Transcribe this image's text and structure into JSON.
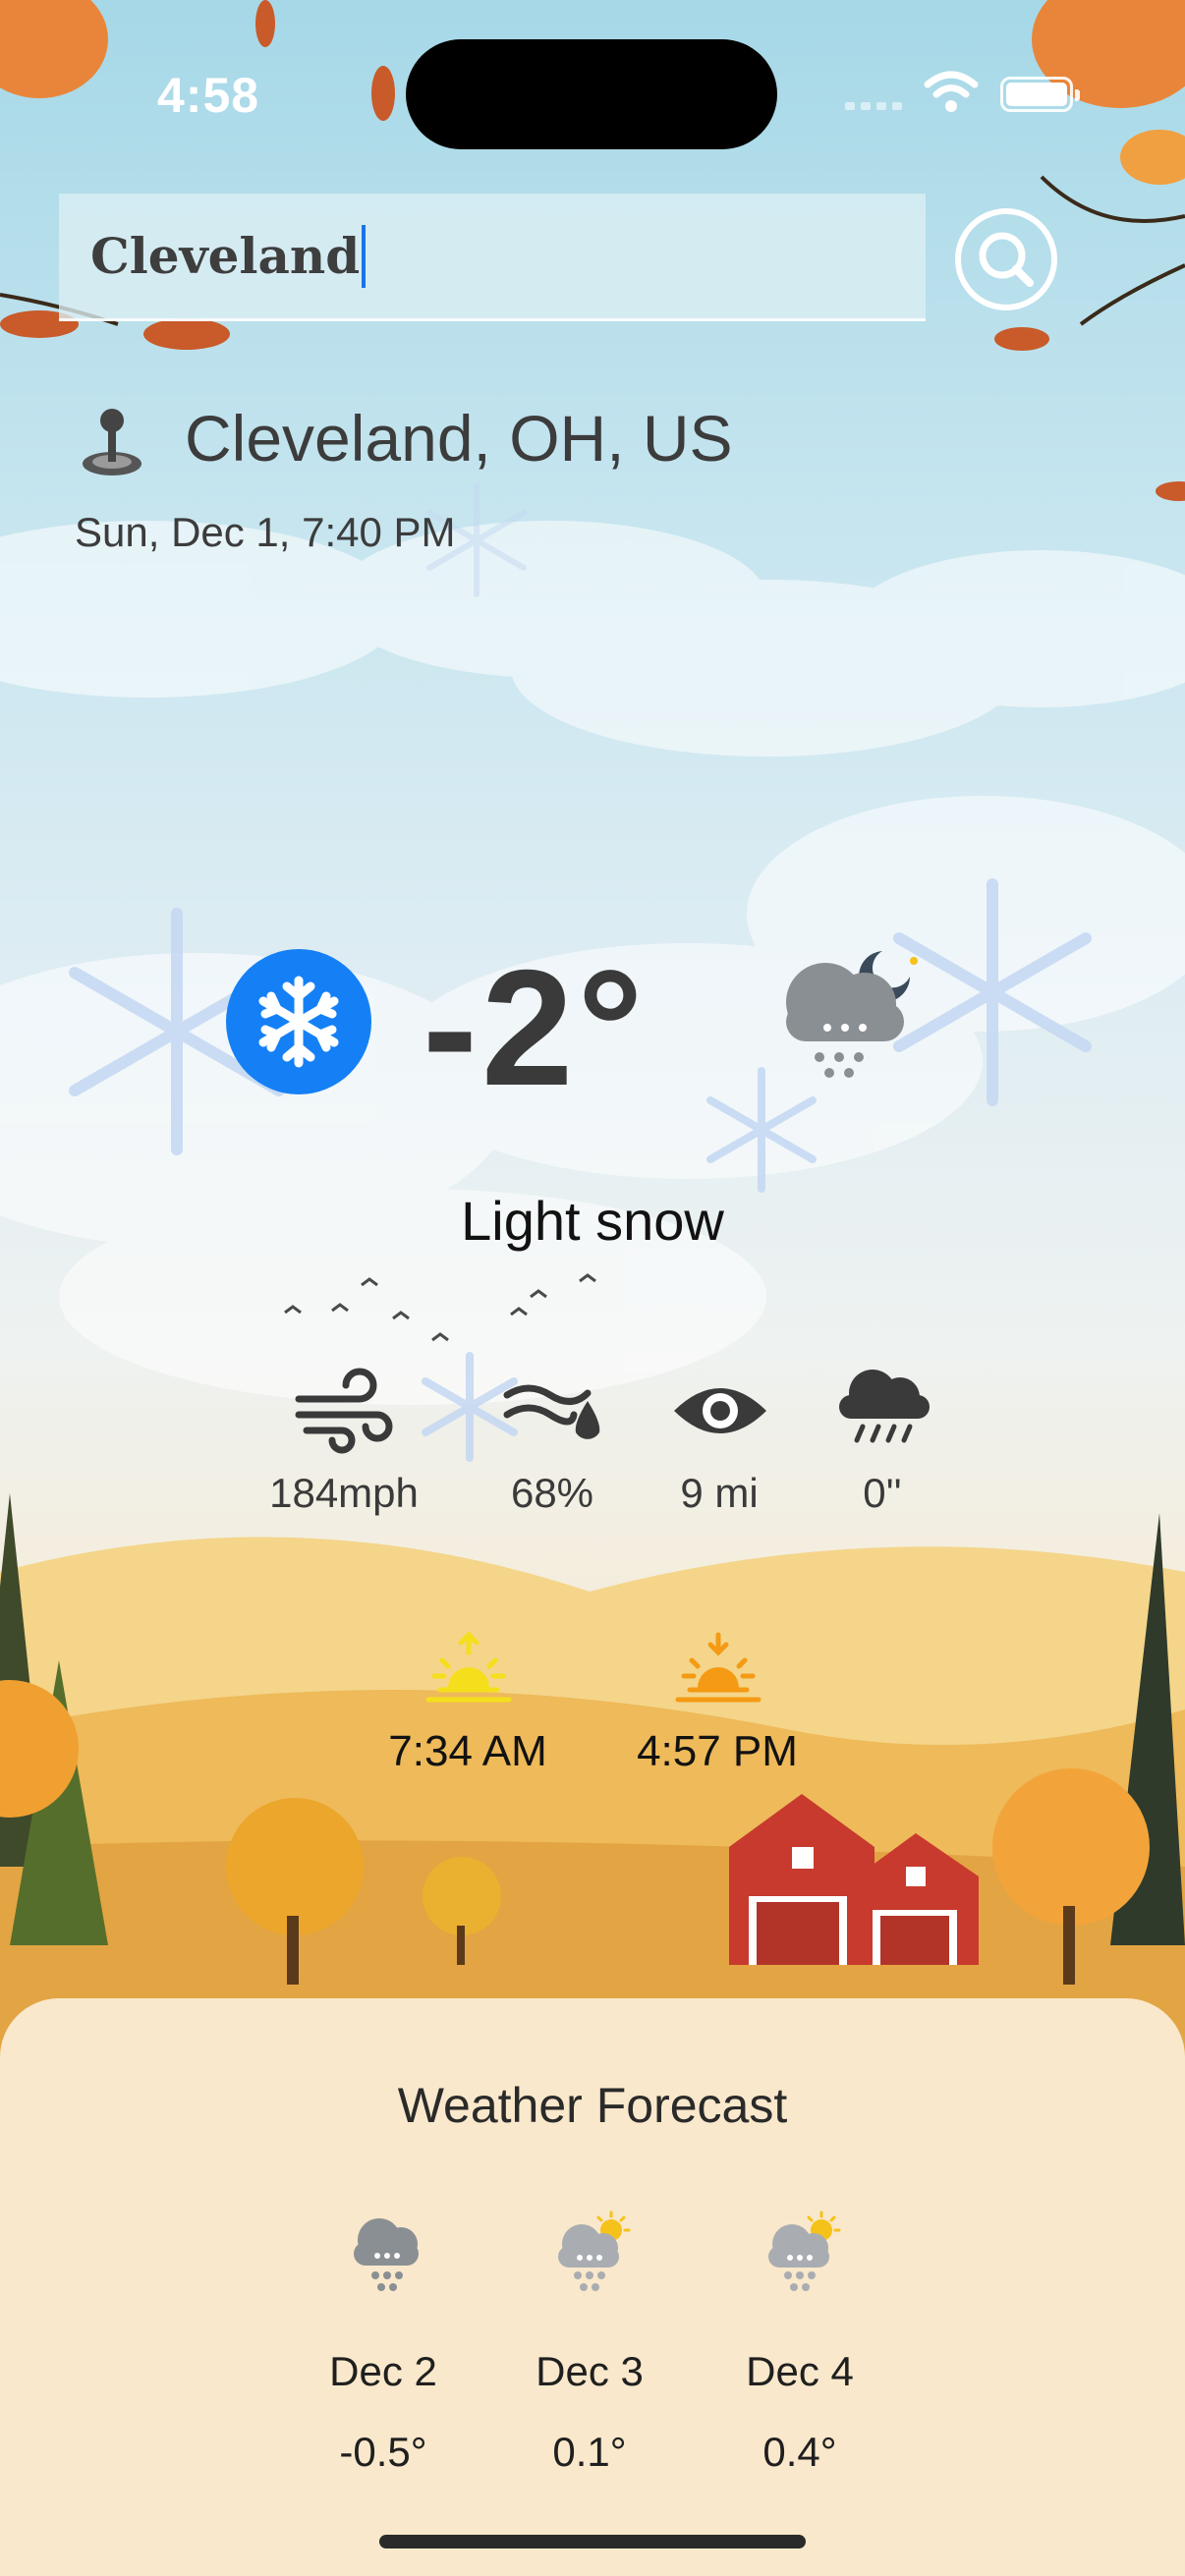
{
  "status_bar": {
    "time": "4:58",
    "icons": [
      "cellular-signal-icon",
      "wifi-icon",
      "battery-icon"
    ]
  },
  "search": {
    "value": "Cleveland",
    "button_icon": "magnifier-icon"
  },
  "location": {
    "name": "Cleveland, OH, US",
    "datetime": "Sun, Dec 1, 7:40 PM"
  },
  "current": {
    "temperature": "-2°",
    "description": "Light snow",
    "condition_icon": "snowflake-icon",
    "weather_icon": "snow-cloud-night-icon",
    "accent_color": "#1580f5"
  },
  "stats": [
    {
      "icon": "wind-icon",
      "value": "184mph"
    },
    {
      "icon": "humidity-icon",
      "value": "68%"
    },
    {
      "icon": "visibility-icon",
      "value": "9 mi"
    },
    {
      "icon": "precipitation-icon",
      "value": "0''"
    }
  ],
  "sun": {
    "sunrise": "7:34 AM",
    "sunset": "4:57 PM",
    "sunrise_color": "#f5df1c",
    "sunset_color": "#f59a14"
  },
  "forecast": {
    "title": "Weather Forecast",
    "days": [
      {
        "date": "Dec 2",
        "temp": "-0.5°",
        "icon": "snow-cloud-icon"
      },
      {
        "date": "Dec 3",
        "temp": "0.1°",
        "icon": "snow-cloud-sun-icon"
      },
      {
        "date": "Dec 4",
        "temp": "0.4°",
        "icon": "snow-cloud-sun-icon"
      }
    ]
  }
}
